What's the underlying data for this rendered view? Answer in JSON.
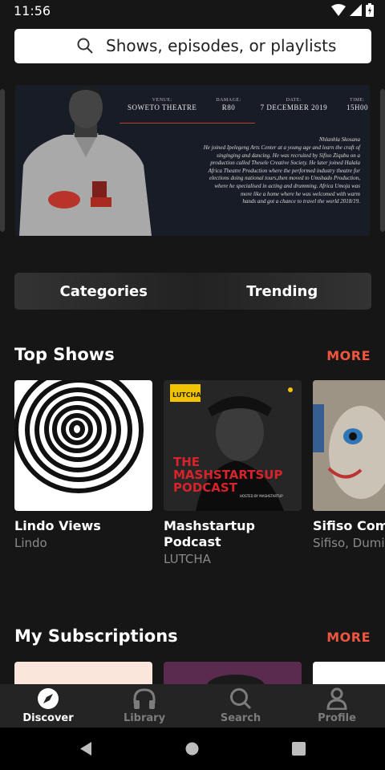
{
  "status": {
    "time": "11:56"
  },
  "search": {
    "placeholder": "Shows, episodes, or playlists"
  },
  "banner": {
    "info": [
      {
        "label": "VENUE:",
        "value": "SOWETO THEATRE"
      },
      {
        "label": "DAMAGE:",
        "value": "R80"
      },
      {
        "label": "DATE:",
        "value": "7 DECEMBER 2019"
      },
      {
        "label": "TIME:",
        "value": "15H00"
      }
    ],
    "bio_name": "Nhlanhla Skosana",
    "bio_lines": [
      "He joined Ipelegeng Arts Center at a young age and learn the craft of",
      "singinging and dancing. He was recruited by Sifiso Ziqubu on a",
      "production called Thesele Creative Society. He later joined Halala",
      "Africa Theatre Production where the performed industry theatre for",
      "elections doing national tours,then moved to Umshado Production,",
      "where he specialised in acting and drumming. Africa Umoja was",
      "more like a home where he was welcomed with warm",
      "hands and got a chance to travel the world 2018/19."
    ]
  },
  "tabs": {
    "categories": "Categories",
    "trending": "Trending"
  },
  "top_shows": {
    "title": "Top Shows",
    "more": "MORE",
    "items": [
      {
        "title": "Lindo Views",
        "author": "Lindo"
      },
      {
        "title": "Mashstartup\nPodcast",
        "author": "LUTCHA",
        "art_tag": "LUTCHA",
        "art_text": "THE MASHSTARTSUP PODCAST",
        "art_sub": "HOSTED BY MASHSTARTUP"
      },
      {
        "title": "Sifiso Com",
        "author": "Sifiso, Dumi"
      }
    ]
  },
  "subscriptions": {
    "title": "My Subscriptions",
    "more": "MORE"
  },
  "bottom_nav": [
    {
      "label": "Discover",
      "icon": "compass-icon",
      "active": true
    },
    {
      "label": "Library",
      "icon": "headphones-icon",
      "active": false
    },
    {
      "label": "Search",
      "icon": "search-icon",
      "active": false
    },
    {
      "label": "Profile",
      "icon": "person-icon",
      "active": false
    }
  ],
  "colors": {
    "accent": "#f0553f",
    "background": "#161616",
    "nav_bg": "#242424"
  }
}
